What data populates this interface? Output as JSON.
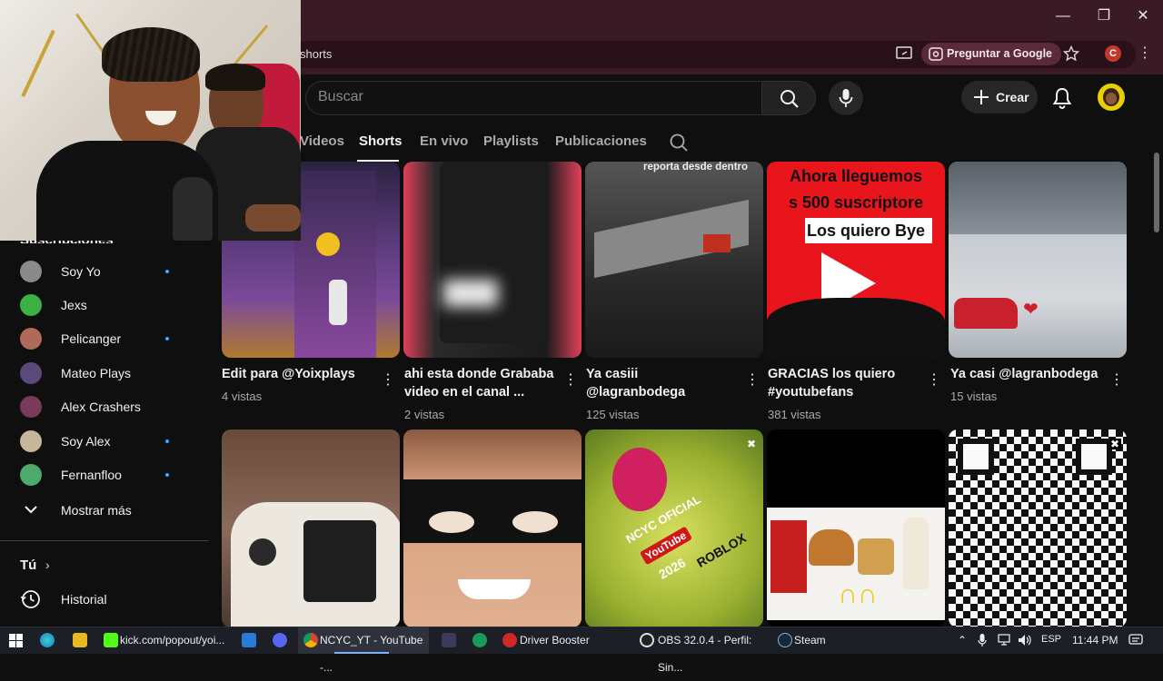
{
  "browser": {
    "url_partial": "shorts",
    "ask_google": "Preguntar a Google",
    "profile_initial": "C"
  },
  "youtube": {
    "search_placeholder": "Buscar",
    "create_label": "Crear",
    "tabs": [
      {
        "label": "Videos",
        "active": false
      },
      {
        "label": "Shorts",
        "active": true
      },
      {
        "label": "En vivo",
        "active": false
      },
      {
        "label": "Playlists",
        "active": false
      },
      {
        "label": "Publicaciones",
        "active": false
      }
    ]
  },
  "sidebar": {
    "subscriptions_header": "Suscripciones",
    "subscriptions": [
      {
        "name": "Soy Yo",
        "new": true,
        "color": "#8a8a8a"
      },
      {
        "name": "Jexs",
        "new": false,
        "color": "#3cb043"
      },
      {
        "name": "Pelicanger",
        "new": true,
        "color": "#b06a5a"
      },
      {
        "name": "Mateo Plays",
        "new": false,
        "color": "#5a4a7a"
      },
      {
        "name": "Alex Crashers",
        "new": false,
        "color": "#7a3a5a"
      },
      {
        "name": "Soy Alex",
        "new": true,
        "color": "#c7b79a"
      },
      {
        "name": "Fernanfloo",
        "new": true,
        "color": "#4caa6a"
      }
    ],
    "show_more": "Mostrar más",
    "you_label": "Tú",
    "history_label": "Historial"
  },
  "shorts": [
    {
      "title": "Edit para @Yoixplays",
      "views": "4 vistas"
    },
    {
      "title": "ahi esta donde Grababa video en el canal ...",
      "views": "2 vistas"
    },
    {
      "title": "Ya casiii @lagranbodega",
      "views": "125 vistas"
    },
    {
      "title": "GRACIAS los quiero #youtubefans",
      "views": "381 vistas"
    },
    {
      "title": "Ya casi @lagranbodega",
      "views": "15 vistas"
    }
  ],
  "thumb_overlays": {
    "t3": "reporta desde dentro",
    "t4_line1": "Ahora lleguemos",
    "t4_line2": "s 500 suscriptore",
    "t4_line3": "Los quiero Bye",
    "r2_t3_line1": "NCYC OFICIAL",
    "r2_t3_line2": "YouTube",
    "r2_t3_line3": "2026",
    "r2_t3_line4": "ROBLOX"
  },
  "taskbar": {
    "items": [
      {
        "label": "kick.com/popout/yoi..."
      },
      {
        "label": "NCYC_YT - YouTube -..."
      },
      {
        "label": "Driver Booster"
      },
      {
        "label": "OBS 32.0.4 - Perfil: Sin..."
      },
      {
        "label": "Steam"
      }
    ],
    "lang": "ESP",
    "time": "11:44 PM"
  }
}
